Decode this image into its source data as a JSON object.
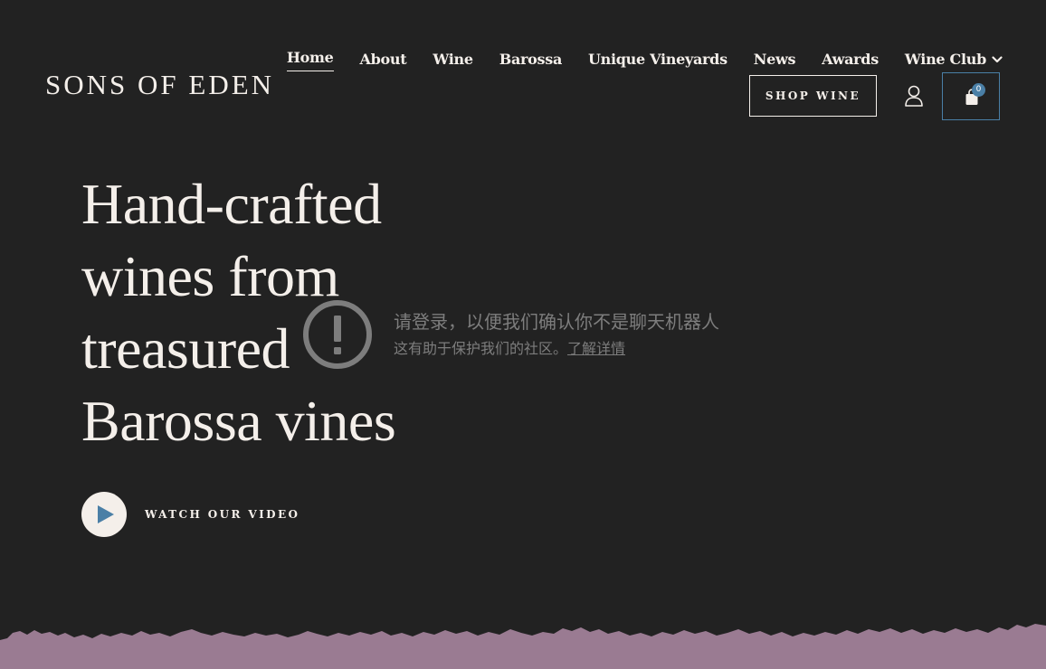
{
  "brand": {
    "logo_text": "SONS OF EDEN"
  },
  "nav": {
    "items": [
      {
        "label": "Home",
        "active": true
      },
      {
        "label": "About"
      },
      {
        "label": "Wine"
      },
      {
        "label": "Barossa"
      },
      {
        "label": "Unique Vineyards"
      },
      {
        "label": "News"
      },
      {
        "label": "Awards"
      },
      {
        "label": "Wine Club",
        "has_dropdown": true
      }
    ]
  },
  "actions": {
    "shop_label": "SHOP WINE",
    "account_icon": "user-icon",
    "cart_icon": "shopping-bag-icon",
    "cart_count": "0"
  },
  "hero": {
    "heading": "Hand-crafted wines from treasured Barossa vines",
    "video_label": "WATCH OUR VIDEO",
    "play_icon": "play-icon"
  },
  "notice": {
    "icon": "exclamation-circle-icon",
    "title": "请登录，以便我们确认你不是聊天机器人",
    "subtitle": "这有助于保护我们的社区。",
    "link": "了解详情"
  },
  "colors": {
    "background": "#222222",
    "text": "#f4efea",
    "accent": "#4a7fa6",
    "footer_band": "#9a7b92",
    "notice_text": "#7d7d7d"
  }
}
